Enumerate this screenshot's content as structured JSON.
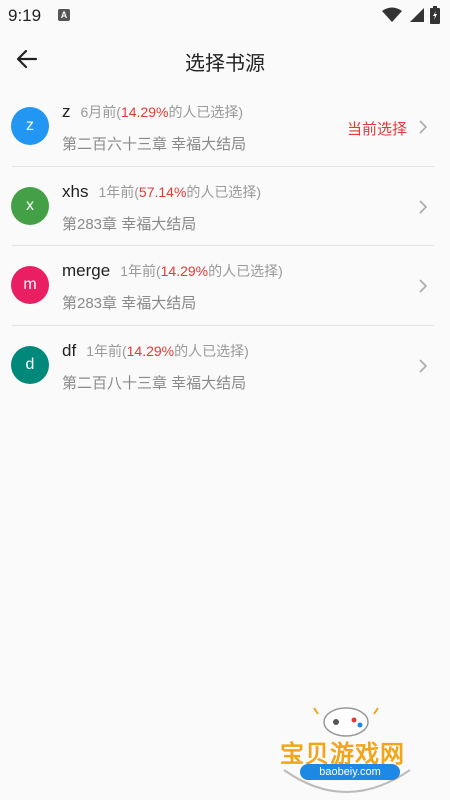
{
  "status": {
    "time": "9:19"
  },
  "header": {
    "title": "选择书源"
  },
  "sources": [
    {
      "initial": "z",
      "color": "#2196f3",
      "name": "z",
      "ago": "6月前(",
      "pct": "14.29%",
      "suffix": "的人已选择)",
      "chapter": "第二百六十三章 幸福大结局",
      "tag": "当前选择"
    },
    {
      "initial": "x",
      "color": "#43a047",
      "name": "xhs",
      "ago": "1年前(",
      "pct": "57.14%",
      "suffix": "的人已选择)",
      "chapter": "第283章 幸福大结局",
      "tag": ""
    },
    {
      "initial": "m",
      "color": "#e91e63",
      "name": "merge",
      "ago": "1年前(",
      "pct": "14.29%",
      "suffix": "的人已选择)",
      "chapter": "第283章 幸福大结局",
      "tag": ""
    },
    {
      "initial": "d",
      "color": "#00897b",
      "name": "df",
      "ago": "1年前(",
      "pct": "14.29%",
      "suffix": "的人已选择)",
      "chapter": "第二百八十三章 幸福大结局",
      "tag": ""
    }
  ],
  "watermark": {
    "brand": "宝贝游戏网",
    "url": "baobeiy.com"
  }
}
